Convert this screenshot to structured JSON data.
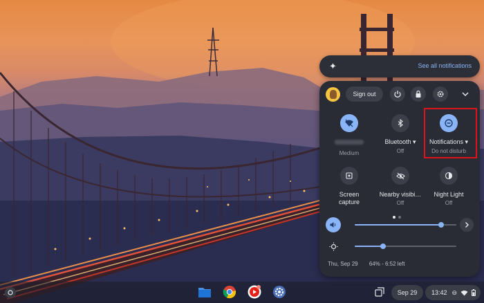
{
  "notifications_bar": {
    "see_all": "See all notifications"
  },
  "quick_settings": {
    "sign_out": "Sign out",
    "tiles": [
      {
        "icon": "wifi-icon",
        "label": "",
        "sublabel": "Medium",
        "active": true
      },
      {
        "icon": "bluetooth-icon",
        "label": "Bluetooth",
        "sublabel": "Off",
        "active": false
      },
      {
        "icon": "do-not-disturb-icon",
        "label": "Notifications",
        "sublabel": "Do not disturb",
        "active": true
      },
      {
        "icon": "screen-capture-icon",
        "label": "Screen\ncapture",
        "sublabel": "",
        "active": false
      },
      {
        "icon": "nearby-share-icon",
        "label": "Nearby visibi…",
        "sublabel": "Off",
        "active": false
      },
      {
        "icon": "night-light-icon",
        "label": "Night Light",
        "sublabel": "Off",
        "active": false
      }
    ],
    "volume_level": 0.85,
    "brightness_level": 0.28,
    "footer": {
      "date": "Thu, Sep 29",
      "battery": "64% - 6:52 left"
    }
  },
  "shelf": {
    "date_pill": "Sep 29",
    "time": "13:42"
  },
  "colors": {
    "accent": "#8ab4f8",
    "highlight_box": "#e0131b"
  }
}
